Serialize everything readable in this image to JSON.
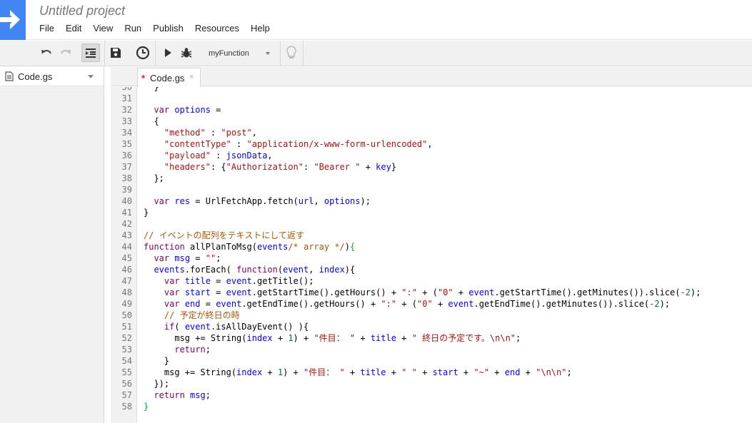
{
  "app": {
    "title": "Untitled project",
    "logo_icon": "apps-script-arrow-icon",
    "accent": "#4285f4"
  },
  "menu": [
    "File",
    "Edit",
    "View",
    "Run",
    "Publish",
    "Resources",
    "Help"
  ],
  "toolbar": {
    "buttons": [
      "undo-icon",
      "redo-icon",
      "indent-icon",
      "save-icon",
      "triggers-clock-icon",
      "run-icon",
      "debug-bug-icon"
    ],
    "function_select": "myFunction",
    "hint_icon": "lightbulb-icon"
  },
  "sidebar": {
    "file_name": "Code.gs"
  },
  "tabs": [
    {
      "modified_marker": "*",
      "name": "Code.gs",
      "close": "×"
    }
  ],
  "editor": {
    "first_line_partial": "30",
    "partial_text": "  }",
    "lines": [
      {
        "n": "31",
        "tokens": []
      },
      {
        "n": "32",
        "tokens": [
          [
            "pl",
            "  "
          ],
          [
            "kw",
            "var"
          ],
          [
            "pl",
            " "
          ],
          [
            "def",
            "options"
          ],
          [
            "pl",
            " ="
          ]
        ]
      },
      {
        "n": "33",
        "tokens": [
          [
            "pl",
            "  {"
          ]
        ]
      },
      {
        "n": "34",
        "tokens": [
          [
            "pl",
            "    "
          ],
          [
            "str",
            "\"method\""
          ],
          [
            "pl",
            " : "
          ],
          [
            "str",
            "\"post\""
          ],
          [
            "pl",
            ","
          ]
        ]
      },
      {
        "n": "35",
        "tokens": [
          [
            "pl",
            "    "
          ],
          [
            "str",
            "\"contentType\""
          ],
          [
            "pl",
            " : "
          ],
          [
            "str",
            "\"application/x-www-form-urlencoded\""
          ],
          [
            "pl",
            ","
          ]
        ]
      },
      {
        "n": "36",
        "tokens": [
          [
            "pl",
            "    "
          ],
          [
            "str",
            "\"payload\""
          ],
          [
            "pl",
            " : "
          ],
          [
            "var",
            "jsonData"
          ],
          [
            "pl",
            ","
          ]
        ]
      },
      {
        "n": "37",
        "tokens": [
          [
            "pl",
            "    "
          ],
          [
            "str",
            "\"headers\""
          ],
          [
            "pl",
            ": {"
          ],
          [
            "str",
            "\"Authorization\""
          ],
          [
            "pl",
            ": "
          ],
          [
            "str",
            "\"Bearer \""
          ],
          [
            "pl",
            " + "
          ],
          [
            "var",
            "key"
          ],
          [
            "pl",
            "}"
          ]
        ]
      },
      {
        "n": "38",
        "tokens": [
          [
            "pl",
            "  };"
          ]
        ]
      },
      {
        "n": "39",
        "tokens": []
      },
      {
        "n": "40",
        "tokens": [
          [
            "pl",
            "  "
          ],
          [
            "kw",
            "var"
          ],
          [
            "pl",
            " "
          ],
          [
            "def",
            "res"
          ],
          [
            "pl",
            " = UrlFetchApp.fetch("
          ],
          [
            "var",
            "url"
          ],
          [
            "pl",
            ", "
          ],
          [
            "var",
            "options"
          ],
          [
            "pl",
            ");"
          ]
        ]
      },
      {
        "n": "41",
        "tokens": [
          [
            "pl",
            "}"
          ]
        ]
      },
      {
        "n": "42",
        "tokens": []
      },
      {
        "n": "43",
        "tokens": [
          [
            "com",
            "// イベントの配列をテキストにして返す"
          ]
        ]
      },
      {
        "n": "44",
        "tokens": [
          [
            "kw",
            "function"
          ],
          [
            "pl",
            " allPlanToMsg("
          ],
          [
            "def",
            "events"
          ],
          [
            "com",
            "/* array */"
          ],
          [
            "pl",
            ")"
          ],
          [
            "br",
            "{"
          ]
        ]
      },
      {
        "n": "45",
        "tokens": [
          [
            "pl",
            "  "
          ],
          [
            "kw",
            "var"
          ],
          [
            "pl",
            " "
          ],
          [
            "def",
            "msg"
          ],
          [
            "pl",
            " = "
          ],
          [
            "str",
            "\"\""
          ],
          [
            "pl",
            ";"
          ]
        ]
      },
      {
        "n": "46",
        "tokens": [
          [
            "pl",
            "  "
          ],
          [
            "var",
            "events"
          ],
          [
            "pl",
            ".forEach( "
          ],
          [
            "kw",
            "function"
          ],
          [
            "pl",
            "("
          ],
          [
            "def",
            "event"
          ],
          [
            "pl",
            ", "
          ],
          [
            "def",
            "index"
          ],
          [
            "pl",
            "){"
          ]
        ]
      },
      {
        "n": "47",
        "tokens": [
          [
            "pl",
            "    "
          ],
          [
            "kw",
            "var"
          ],
          [
            "pl",
            " "
          ],
          [
            "def",
            "title"
          ],
          [
            "pl",
            " = "
          ],
          [
            "var",
            "event"
          ],
          [
            "pl",
            ".getTitle();"
          ]
        ]
      },
      {
        "n": "48",
        "tokens": [
          [
            "pl",
            "    "
          ],
          [
            "kw",
            "var"
          ],
          [
            "pl",
            " "
          ],
          [
            "def",
            "start"
          ],
          [
            "pl",
            " = "
          ],
          [
            "var",
            "event"
          ],
          [
            "pl",
            ".getStartTime().getHours() + "
          ],
          [
            "str",
            "\":\""
          ],
          [
            "pl",
            " + ("
          ],
          [
            "str",
            "\"0\""
          ],
          [
            "pl",
            " + "
          ],
          [
            "var",
            "event"
          ],
          [
            "pl",
            ".getStartTime().getMinutes()).slice("
          ],
          [
            "num",
            "-2"
          ],
          [
            "pl",
            ");"
          ]
        ]
      },
      {
        "n": "49",
        "tokens": [
          [
            "pl",
            "    "
          ],
          [
            "kw",
            "var"
          ],
          [
            "pl",
            " "
          ],
          [
            "def",
            "end"
          ],
          [
            "pl",
            " = "
          ],
          [
            "var",
            "event"
          ],
          [
            "pl",
            ".getEndTime().getHours() + "
          ],
          [
            "str",
            "\":\""
          ],
          [
            "pl",
            " + ("
          ],
          [
            "str",
            "\"0\""
          ],
          [
            "pl",
            " + "
          ],
          [
            "var",
            "event"
          ],
          [
            "pl",
            ".getEndTime().getMinutes()).slice("
          ],
          [
            "num",
            "-2"
          ],
          [
            "pl",
            ");"
          ]
        ]
      },
      {
        "n": "50",
        "tokens": [
          [
            "pl",
            "    "
          ],
          [
            "com",
            "// 予定が終日の時"
          ]
        ]
      },
      {
        "n": "51",
        "tokens": [
          [
            "pl",
            "    "
          ],
          [
            "kw",
            "if"
          ],
          [
            "pl",
            "( "
          ],
          [
            "var",
            "event"
          ],
          [
            "pl",
            ".isAllDayEvent() ){"
          ]
        ]
      },
      {
        "n": "52",
        "tokens": [
          [
            "pl",
            "      msg += String("
          ],
          [
            "var",
            "index"
          ],
          [
            "pl",
            " + "
          ],
          [
            "num",
            "1"
          ],
          [
            "pl",
            ") + "
          ],
          [
            "str",
            "\"件目： \""
          ],
          [
            "pl",
            " + "
          ],
          [
            "var",
            "title"
          ],
          [
            "pl",
            " + "
          ],
          [
            "str",
            "\" 終日の予定です。\\n\\n\""
          ],
          [
            "pl",
            ";"
          ]
        ]
      },
      {
        "n": "53",
        "tokens": [
          [
            "pl",
            "      "
          ],
          [
            "kw",
            "return"
          ],
          [
            "pl",
            ";"
          ]
        ]
      },
      {
        "n": "54",
        "tokens": [
          [
            "pl",
            "    }"
          ]
        ]
      },
      {
        "n": "55",
        "tokens": [
          [
            "pl",
            "    msg += String("
          ],
          [
            "var",
            "index"
          ],
          [
            "pl",
            " + "
          ],
          [
            "num",
            "1"
          ],
          [
            "pl",
            ") + "
          ],
          [
            "str",
            "\"件目： \""
          ],
          [
            "pl",
            " + "
          ],
          [
            "var",
            "title"
          ],
          [
            "pl",
            " + "
          ],
          [
            "str",
            "\" \""
          ],
          [
            "pl",
            " + "
          ],
          [
            "var",
            "start"
          ],
          [
            "pl",
            " + "
          ],
          [
            "str",
            "\"~\""
          ],
          [
            "pl",
            " + "
          ],
          [
            "var",
            "end"
          ],
          [
            "pl",
            " + "
          ],
          [
            "str",
            "\"\\n\\n\""
          ],
          [
            "pl",
            ";"
          ]
        ]
      },
      {
        "n": "56",
        "tokens": [
          [
            "pl",
            "  });"
          ]
        ]
      },
      {
        "n": "57",
        "tokens": [
          [
            "pl",
            "  "
          ],
          [
            "kw",
            "return"
          ],
          [
            "pl",
            " "
          ],
          [
            "var",
            "msg"
          ],
          [
            "pl",
            ";"
          ]
        ]
      },
      {
        "n": "58",
        "tokens": [
          [
            "br",
            "}"
          ]
        ]
      }
    ]
  }
}
